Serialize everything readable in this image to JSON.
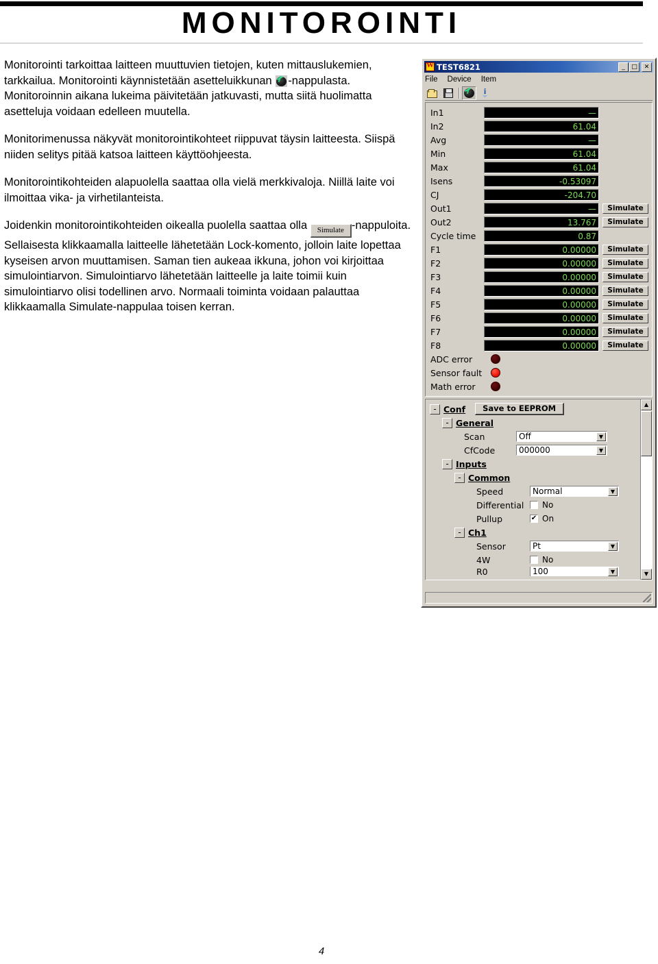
{
  "page": {
    "title": "MONITOROINTI",
    "number": "4"
  },
  "prose": {
    "p1_a": "Monitorointi tarkoittaa laitteen muuttuvien tietojen, kuten mittauslukemien, tarkkailua. Monitorointi käynnistetään asetteluikkunan ",
    "p1_icon": "monitor-start-icon",
    "p1_b": "-nappulasta. Monitoroinnin aikana lukeima päivitetään jatkuvasti, mutta siitä huolimatta asetteluja voidaan edelleen muutella.",
    "p2": "Monitorimenussa näkyvät monitorointikohteet riippuvat täysin laitteesta. Siispä niiden selitys pitää katsoa laitteen käyttöohjeesta.",
    "p3": "Monitorointikohteiden alapuolella saattaa olla vielä merkkivaloja. Niillä laite voi ilmoittaa vika- ja virhetilanteista.",
    "p4_a": "Joidenkin monitorointikohteiden oikealla puolella saattaa olla ",
    "p4_btn": "Simulate",
    "p4_b": "-nappuloita. Sellaisesta klikkaamalla laitteelle lähetetään Lock-komento, jolloin laite lopettaa kyseisen arvon muuttamisen. Saman tien aukeaa ikkuna, johon voi kirjoittaa simulointiarvon. Simulointiarvo lähetetään laitteelle ja laite toimii kuin simulointiarvo olisi todellinen arvo. Normaali toiminta voidaan palauttaa klikkaamalla Simulate-nappulaa toisen kerran."
  },
  "app": {
    "title": "TEST6821",
    "window_buttons": {
      "minimize": "_",
      "maximize": "□",
      "close": "✕"
    },
    "menu": [
      {
        "label": "File"
      },
      {
        "label": "Device"
      },
      {
        "label": "Item"
      }
    ],
    "toolbar": [
      {
        "name": "open-icon",
        "pressed": false
      },
      {
        "name": "save-icon",
        "pressed": false
      },
      {
        "name": "monitor-icon",
        "pressed": true
      },
      {
        "name": "info-icon",
        "pressed": false
      }
    ],
    "monitor_items": [
      {
        "label": "In1",
        "value": "—",
        "simulate": null
      },
      {
        "label": "In2",
        "value": "61.04",
        "simulate": null
      },
      {
        "label": "Avg",
        "value": "—",
        "simulate": null
      },
      {
        "label": "Min",
        "value": "61.04",
        "simulate": null
      },
      {
        "label": "Max",
        "value": "61.04",
        "simulate": null
      },
      {
        "label": "Isens",
        "value": "-0.53097",
        "simulate": null
      },
      {
        "label": "CJ",
        "value": "-204.70",
        "simulate": null
      },
      {
        "label": "Out1",
        "value": "—",
        "simulate": "Simulate"
      },
      {
        "label": "Out2",
        "value": "13.767",
        "simulate": "Simulate"
      },
      {
        "label": "Cycle time",
        "value": "0.87",
        "simulate": null
      },
      {
        "label": "F1",
        "value": "0.00000",
        "simulate": "Simulate"
      },
      {
        "label": "F2",
        "value": "0.00000",
        "simulate": "Simulate"
      },
      {
        "label": "F3",
        "value": "0.00000",
        "simulate": "Simulate"
      },
      {
        "label": "F4",
        "value": "0.00000",
        "simulate": "Simulate"
      },
      {
        "label": "F5",
        "value": "0.00000",
        "simulate": "Simulate"
      },
      {
        "label": "F6",
        "value": "0.00000",
        "simulate": "Simulate"
      },
      {
        "label": "F7",
        "value": "0.00000",
        "simulate": "Simulate"
      },
      {
        "label": "F8",
        "value": "0.00000",
        "simulate": "Simulate"
      }
    ],
    "leds": [
      {
        "label": "ADC error",
        "state": "off"
      },
      {
        "label": "Sensor fault",
        "state": "on"
      },
      {
        "label": "Math error",
        "state": "off"
      }
    ],
    "config": {
      "save_button": "Save to EEPROM",
      "nodes": {
        "conf": "Conf",
        "general": "General",
        "inputs": "Inputs",
        "common": "Common",
        "ch1": "Ch1"
      },
      "fields": {
        "scan": {
          "label": "Scan",
          "value": "Off"
        },
        "cfcode": {
          "label": "CfCode",
          "value": "000000"
        },
        "speed": {
          "label": "Speed",
          "value": "Normal"
        },
        "differential": {
          "label": "Differential",
          "value": "No",
          "checked": false
        },
        "pullup": {
          "label": "Pullup",
          "value": "On",
          "checked": true
        },
        "sensor": {
          "label": "Sensor",
          "value": "Pt"
        },
        "fourw": {
          "label": "4W",
          "value": "No",
          "checked": false
        },
        "r0": {
          "label": "R0",
          "value": "100"
        }
      },
      "expander_symbol": "-",
      "dropdown_symbol": "▼",
      "check_symbol": "✔"
    },
    "scrollbar": {
      "up": "▲",
      "down": "▼"
    },
    "statusbar_text": ""
  },
  "colors": {
    "value_text": "#7ed957",
    "value_bg": "#000000",
    "window_face": "#d4d0c8",
    "titlebar": "#0a246a",
    "led_on": "#f21607",
    "led_off": "#3a0505"
  }
}
